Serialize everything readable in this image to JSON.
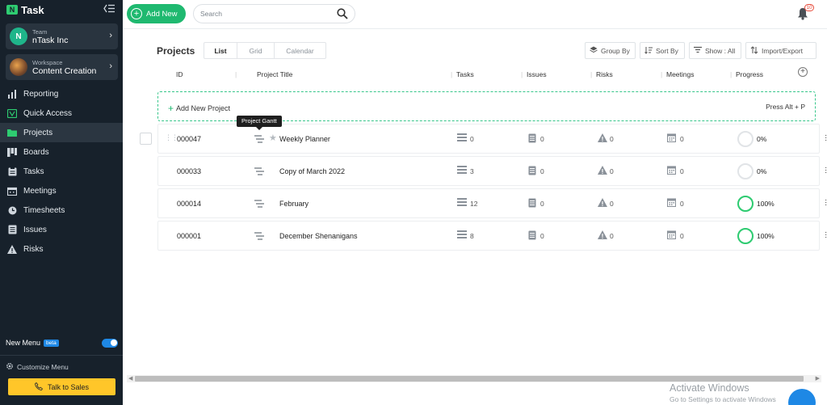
{
  "app": {
    "name": "Task",
    "logo_letter": "N"
  },
  "sidebar": {
    "team": {
      "caption": "Team",
      "name": "nTask Inc",
      "initial": "N"
    },
    "workspace": {
      "caption": "Workspace",
      "name": "Content Creation"
    },
    "items": [
      {
        "label": "Reporting",
        "icon": "reporting-icon"
      },
      {
        "label": "Quick Access",
        "icon": "quick-access-icon"
      },
      {
        "label": "Projects",
        "icon": "folder-icon",
        "active": true
      },
      {
        "label": "Boards",
        "icon": "boards-icon"
      },
      {
        "label": "Tasks",
        "icon": "tasks-icon"
      },
      {
        "label": "Meetings",
        "icon": "calendar-icon"
      },
      {
        "label": "Timesheets",
        "icon": "timesheet-icon"
      },
      {
        "label": "Issues",
        "icon": "issues-icon"
      },
      {
        "label": "Risks",
        "icon": "warning-icon"
      }
    ],
    "new_menu": {
      "label": "New Menu",
      "badge": "beta",
      "enabled": true
    },
    "customize": "Customize Menu",
    "talk_to_sales": "Talk to Sales"
  },
  "topbar": {
    "add_new": "Add New",
    "search_placeholder": "Search",
    "notification_count": "10"
  },
  "main": {
    "title": "Projects",
    "views": [
      "List",
      "Grid",
      "Calendar"
    ],
    "active_view": "List",
    "toolbar": {
      "group_by": "Group By",
      "sort_by": "Sort By",
      "show": "Show : All",
      "import_export": "Import/Export"
    },
    "columns": [
      "ID",
      "Project Title",
      "Tasks",
      "Issues",
      "Risks",
      "Meetings",
      "Progress"
    ],
    "add_project": {
      "label": "Add New Project",
      "hint": "Press Alt + P"
    },
    "tooltip": "Project Gantt",
    "rows": [
      {
        "id": "000047",
        "title": "Weekly Planner",
        "tasks": "0",
        "issues": "0",
        "risks": "0",
        "meetings": "0",
        "progress": "0%",
        "progress_value": 0
      },
      {
        "id": "000033",
        "title": "Copy of March 2022",
        "tasks": "3",
        "issues": "0",
        "risks": "0",
        "meetings": "0",
        "progress": "0%",
        "progress_value": 0
      },
      {
        "id": "000014",
        "title": "February",
        "tasks": "12",
        "issues": "0",
        "risks": "0",
        "meetings": "0",
        "progress": "100%",
        "progress_value": 100
      },
      {
        "id": "000001",
        "title": "December Shenanigans",
        "tasks": "8",
        "issues": "0",
        "risks": "0",
        "meetings": "0",
        "progress": "100%",
        "progress_value": 100
      }
    ]
  },
  "watermark": {
    "line1": "Activate Windows",
    "line2": "Go to Settings to activate Windows"
  },
  "colors": {
    "brand_green": "#1fb970",
    "sidebar_bg": "#17212b",
    "accent_blue": "#1e88e5",
    "sales_yellow": "#ffc629"
  }
}
